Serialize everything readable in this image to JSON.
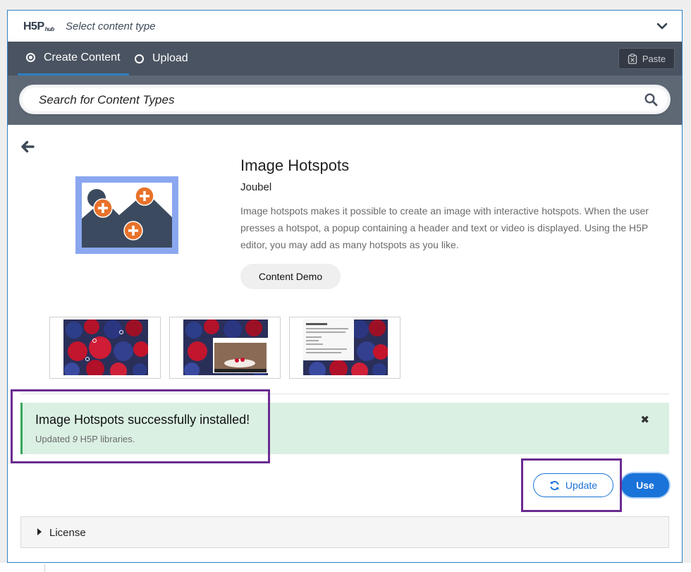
{
  "header": {
    "logo": "H5P",
    "logo_sub": "hub",
    "title": "Select content type"
  },
  "tabs": {
    "create": "Create Content",
    "upload": "Upload",
    "paste": "Paste"
  },
  "search": {
    "placeholder": "Search for Content Types"
  },
  "content_type": {
    "title": "Image Hotspots",
    "owner": "Joubel",
    "description": "Image hotspots makes it possible to create an image with interactive hotspots. When the user presses a hotspot, a popup containing a header and text or video is displayed. Using the H5P editor, you may add as many hotspots as you like.",
    "demo_label": "Content Demo"
  },
  "message": {
    "title": "Image Hotspots successfully installed!",
    "text_prefix": "Updated ",
    "count": "9",
    "text_suffix": " H5P libraries.",
    "close": "✖"
  },
  "actions": {
    "update": "Update",
    "use": "Use"
  },
  "license": {
    "label": "License"
  },
  "colors": {
    "accent": "#1a73d9",
    "nav": "#4a5361",
    "search_bar": "#5e6875",
    "success_bg": "#daf0e3",
    "success_border": "#38a85c",
    "highlight": "#6a2c91"
  }
}
